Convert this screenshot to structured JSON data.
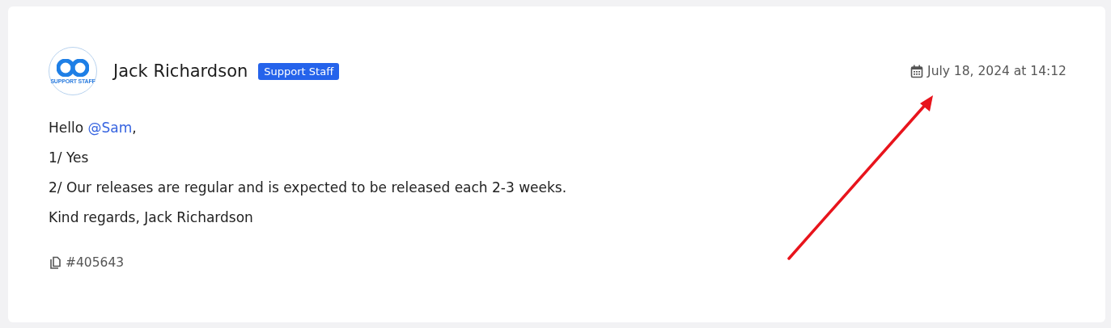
{
  "post": {
    "avatar_label": "SUPPORT STAFF",
    "author": "Jack Richardson",
    "badge": "Support Staff",
    "date": "July 18, 2024 at 14:12",
    "body": [
      {
        "parts": [
          {
            "kind": "text",
            "text": "Hello "
          },
          {
            "kind": "mention",
            "text": "@Sam"
          },
          {
            "kind": "text",
            "text": ","
          }
        ]
      },
      {
        "parts": [
          {
            "kind": "text",
            "text": "1/ Yes"
          }
        ]
      },
      {
        "parts": [
          {
            "kind": "text",
            "text": "2/ Our releases are regular and is expected to be released each 2-3 weeks."
          }
        ]
      },
      {
        "parts": [
          {
            "kind": "text",
            "text": "Kind regards, Jack Richardson"
          }
        ]
      }
    ],
    "post_id": "#405643"
  }
}
